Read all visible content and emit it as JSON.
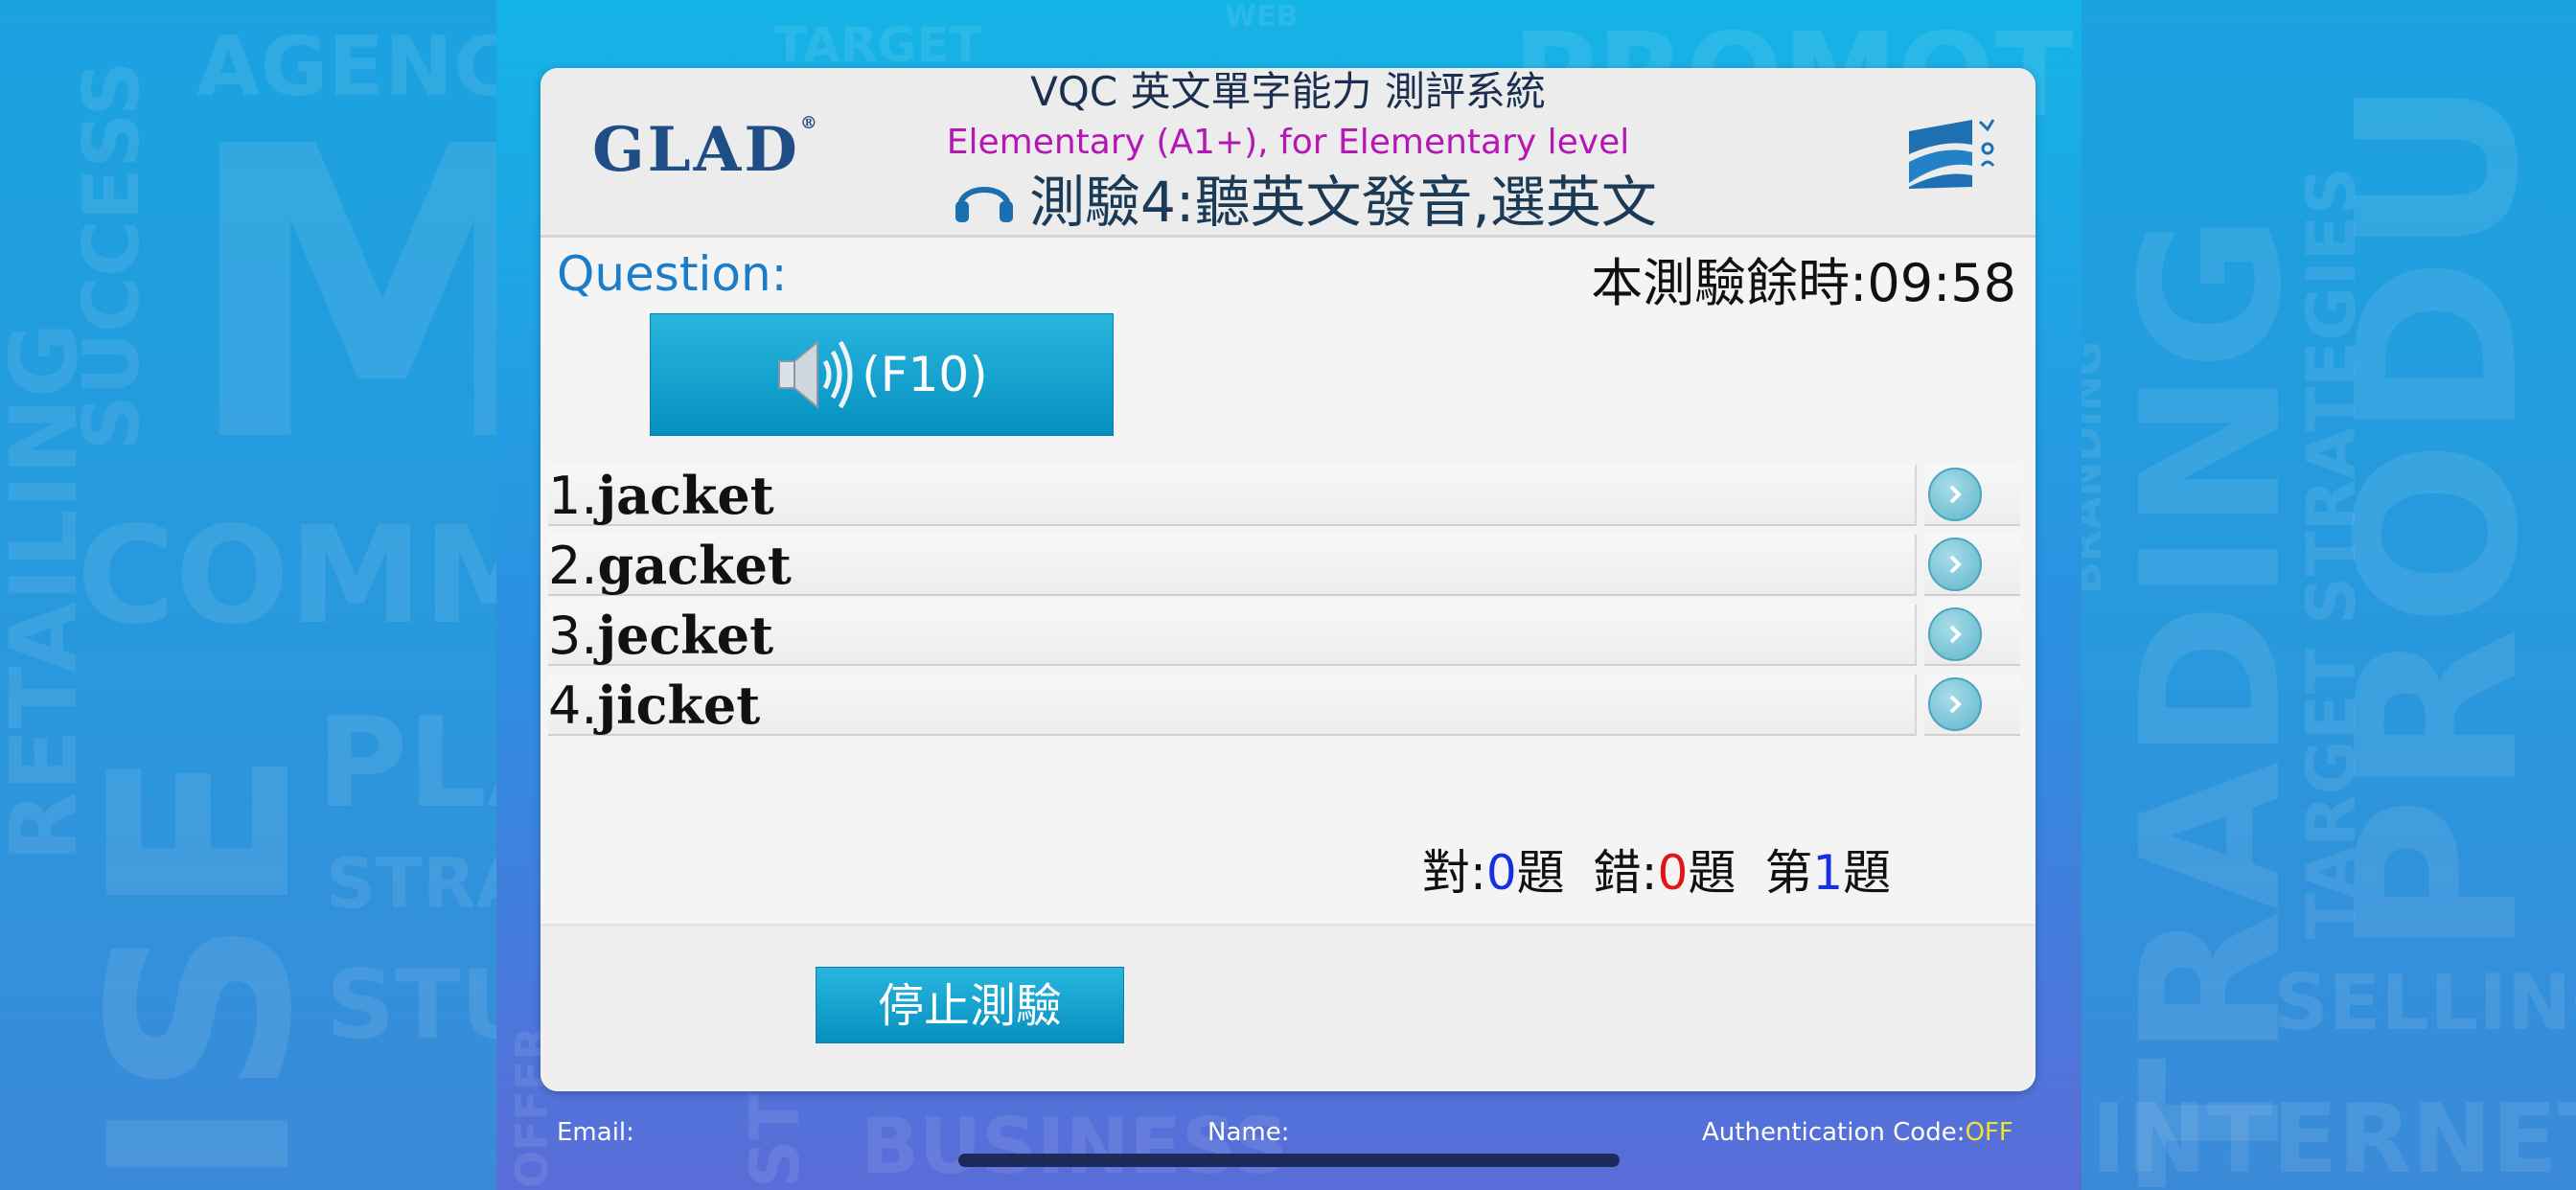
{
  "background": {
    "words": [
      "AGENCY",
      "SUCCESS",
      "COMM",
      "PLA",
      "STRAT",
      "STUD",
      "RETAILING",
      "ISE",
      "M",
      "TARGET",
      "WEB",
      "PROMOTI",
      "BRANDING",
      "TRADING",
      "TARGET STRATEGIES",
      "PRODU",
      "SELLING",
      "INTERNET",
      "BUSINESS",
      "STUDY",
      "OFFER"
    ]
  },
  "header": {
    "logo": "GLAD",
    "logo_mark": "®",
    "system_title": "VQC 英文單字能力 測評系統",
    "level": "Elementary (A1+), for Elementary level",
    "test_title": "測驗4:聽英文發音,選英文"
  },
  "question": {
    "label": "Question:",
    "timer": "本測驗餘時:09:58",
    "audio_button": "(F10)"
  },
  "options": [
    {
      "num": "1.",
      "word": "jacket"
    },
    {
      "num": "2.",
      "word": "gacket"
    },
    {
      "num": "3.",
      "word": "jecket"
    },
    {
      "num": "4.",
      "word": "jicket"
    }
  ],
  "score": {
    "correct_label": "對:",
    "correct_value": "0",
    "correct_unit": "題",
    "wrong_label": "錯:",
    "wrong_value": "0",
    "wrong_unit": "題",
    "question_label": "第",
    "question_value": "1",
    "question_unit": "題"
  },
  "stop_button": "停止測驗",
  "footer": {
    "email_label": "Email:",
    "name_label": "Name:",
    "auth_label": "Authentication Code:",
    "auth_value": "OFF"
  },
  "colors": {
    "accent": "#1c7cc8",
    "level": "#b417b4",
    "button": "#0a9fcf",
    "correct": "#1530e0",
    "wrong": "#e01616",
    "auth_off": "#f3e22b"
  }
}
